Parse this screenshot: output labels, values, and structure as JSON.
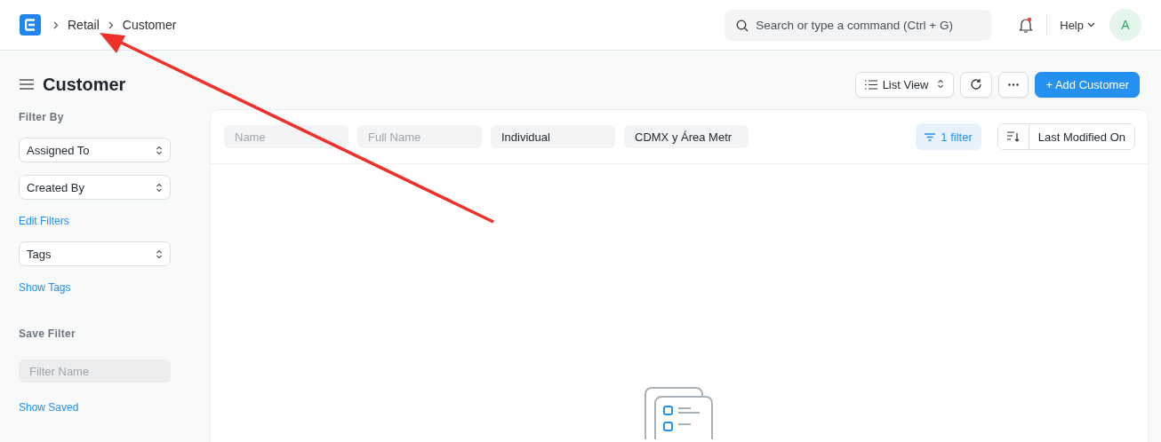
{
  "navbar": {
    "breadcrumbs": [
      "Retail",
      "Customer"
    ],
    "search": {
      "placeholder": "Search or type a command (Ctrl + G)"
    },
    "notification_unread": true,
    "help": "Help",
    "avatar": "A"
  },
  "page": {
    "title": "Customer",
    "view_switcher": "List View",
    "add_button": "+ Add Customer"
  },
  "sidebar": {
    "filter_heading": "Filter By",
    "group_by": [
      "Assigned To",
      "Created By"
    ],
    "edit_filters": "Edit Filters",
    "tags": "Tags",
    "show_tags": "Show Tags",
    "save_heading": "Save Filter",
    "filter_name": {
      "placeholder": "Filter Name"
    },
    "show_saved": "Show Saved"
  },
  "filters": [
    {
      "placeholder": "Name"
    },
    {
      "placeholder": "Full Name"
    },
    {
      "value": "Individual"
    },
    {
      "value": "CDMX y Área Metr"
    }
  ],
  "filter_button": "1 filter",
  "sort": "Last Modified On"
}
